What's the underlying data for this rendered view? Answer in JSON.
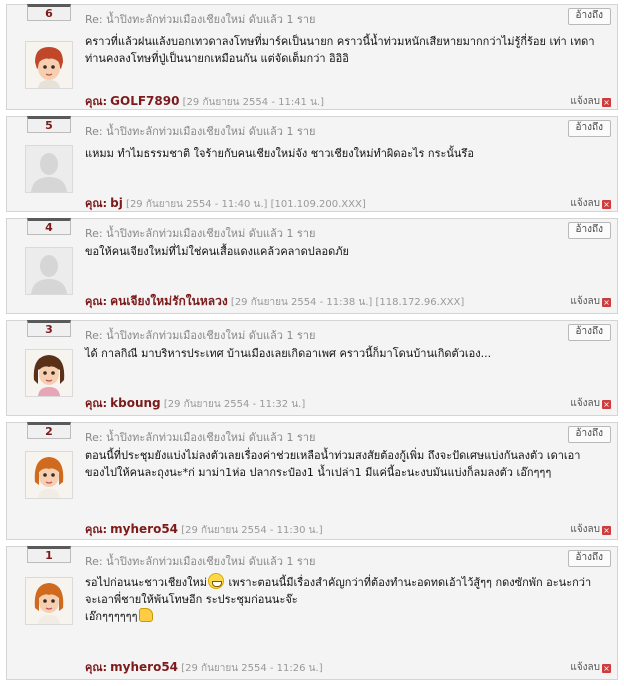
{
  "comments": [
    {
      "number": "6",
      "topic": "Re: น้ำปิงทะลักท่วมเมืองเชียงใหม่ ดับแล้ว 1 ราย",
      "quote_label": "อ้างถึง",
      "avatar": "redhead-boy-avatar",
      "body": "คราวที่แล้วฝนแล้งบอกเทวดาลงโทษที่มาร์คเป็นนายก คราวนี้น้ำท่วมหนักเสียหายมากกว่าไม่รู้กี่ร้อย เท่า เทดาท่านคงลงโทษที่ปู่เป็นนายกเหมือนกัน แต่จัดเต็มกว่า อิอิอิ",
      "author_label": "คุณ:",
      "author": "GOLF7890",
      "date": "[29 กันยายน 2554 - 11:41 น.]",
      "ip": "",
      "report_label": "แจ้งลบ"
    },
    {
      "number": "5",
      "topic": "Re: น้ำปิงทะลักท่วมเมืองเชียงใหม่ ดับแล้ว 1 ราย",
      "quote_label": "อ้างถึง",
      "avatar": "default-user-avatar",
      "body": "แหมม ทำไมธรรมชาติ ใจร้ายกับคนเชียงใหม่จัง ชาวเชียงใหม่ทำผิดอะไร กระนั้นรึอ",
      "author_label": "คุณ:",
      "author": "bj",
      "date": "[29 กันยายน 2554 - 11:40 น.]",
      "ip": "[101.109.200.XXX]",
      "report_label": "แจ้งลบ"
    },
    {
      "number": "4",
      "topic": "Re: น้ำปิงทะลักท่วมเมืองเชียงใหม่ ดับแล้ว 1 ราย",
      "quote_label": "อ้างถึง",
      "avatar": "default-user-avatar",
      "body": "ขอให้คนเจียงใหม่ที่ไม่ใช่คนเสื้อแดงแคล้วคลาดปลอดภัย",
      "author_label": "คุณ:",
      "author": "คนเจียงใหม่รักในหลวง",
      "date": "[29 กันยายน 2554 - 11:38 น.]",
      "ip": "[118.172.96.XXX]",
      "report_label": "แจ้งลบ"
    },
    {
      "number": "3",
      "topic": "Re: น้ำปิงทะลักท่วมเมืองเชียงใหม่ ดับแล้ว 1 ราย",
      "quote_label": "อ้างถึง",
      "avatar": "brunette-girl-avatar",
      "body": "ได้ กาลกิณี มาบริหารประเทศ บ้านเมืองเลยเกิดอาเพศ คราวนี้ก็มาโดนบ้านเกิดตัวเอง...",
      "author_label": "คุณ:",
      "author": "kboung",
      "date": "[29 กันยายน 2554 - 11:32 น.]",
      "ip": "",
      "report_label": "แจ้งลบ"
    },
    {
      "number": "2",
      "topic": "Re: น้ำปิงทะลักท่วมเมืองเชียงใหม่ ดับแล้ว 1 ราย",
      "quote_label": "อ้างถึง",
      "avatar": "ginger-girl-avatar",
      "body": "ตอนนี้ที่ประชุมยังแบ่งไม่ลงตัวเลยเรื่องค่าช่วยเหลือน้ำท่วมสงสัยต้องกู้เพิ่ม ถึงจะปัดเศษแบ่งกันลงตัว เดาเอาของไปให้คนละถุงนะ*ก่ มาม่า1ห่อ ปลากระป๋อง1 น้ำเปล่า1 มีแค่นี้อะนะงบมันแบ่งก็ลมลงตัว เอ๊กๆๆๆ",
      "author_label": "คุณ:",
      "author": "myhero54",
      "date": "[29 กันยายน 2554 - 11:30 น.]",
      "ip": "",
      "report_label": "แจ้งลบ"
    },
    {
      "number": "1",
      "topic": "Re: น้ำปิงทะลักท่วมเมืองเชียงใหม่ ดับแล้ว 1 ราย",
      "quote_label": "อ้างถึง",
      "avatar": "ginger-girl-avatar",
      "body_part1": "รอไปก่อนนะชาวเชียงใหม่",
      "body_part2": " เพราะตอนนี้มีเรื่องสำคัญกว่าที่ต้องทำนะอดทดเอ้าไว้สู้ๆๆ กดงซักพัก อะนะกว่าจะเอาพี่ชายให้พ้นโทษอีก ระประชุมก่อนนะจ๊ะ",
      "body_part3": "เอ๊กๆๆๆๆๆๆ",
      "author_label": "คุณ:",
      "author": "myhero54",
      "date": "[29 กันยายน 2554 - 11:26 น.]",
      "ip": "",
      "report_label": "แจ้งลบ"
    }
  ],
  "colors": {
    "author": "#7b1b1b",
    "meta": "#999999",
    "panel": "#f4f4f4",
    "report_icon": "#d23b3b"
  }
}
